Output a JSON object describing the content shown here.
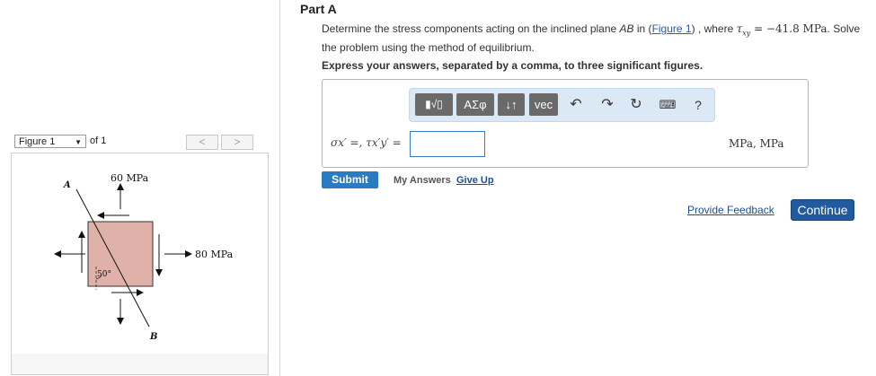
{
  "figure_panel": {
    "selected": "Figure 1",
    "of_label": "of 1",
    "prev_glyph": "<",
    "next_glyph": ">",
    "diagram": {
      "label_a": "A",
      "label_b": "B",
      "top_stress": "60 MPa",
      "right_stress": "80 MPa",
      "angle": "50°"
    }
  },
  "problem": {
    "part_title": "Part A",
    "q_prefix": "Determine the stress components acting on the inclined plane ",
    "q_plane": "AB",
    "q_mid": " in (",
    "q_link": "Figure 1",
    "q_after_link": ") , where ",
    "q_symbol": "τ",
    "q_subscript": "xy",
    "q_equals": " = −41.8 MPa",
    "q_suffix": ". Solve the problem using the method of equilibrium.",
    "instruction": "Express your answers, separated by a comma, to three significant figures."
  },
  "toolbar": {
    "templates_icon": "▮√▯",
    "greek_label": "ΑΣφ",
    "arrows_label": "↓↑",
    "vec_label": "vec",
    "undo_icon": "undo-arrow",
    "redo_icon": "redo-arrow",
    "reset_icon": "reset-circle",
    "keyboard_icon": "keyboard",
    "help_label": "?"
  },
  "answer": {
    "equation_label": "σx′ =, τx′y′ =",
    "value": "",
    "units": "MPa, MPa"
  },
  "actions": {
    "submit": "Submit",
    "my_answers": "My Answers",
    "give_up": "Give Up",
    "feedback": "Provide Feedback",
    "continue": "Continue"
  },
  "colors": {
    "element_fill": "#e0b1a9",
    "submit_bg": "#2a7bc0",
    "continue_bg": "#1f5b9e",
    "toolbar_bg": "#dbe8f5"
  }
}
